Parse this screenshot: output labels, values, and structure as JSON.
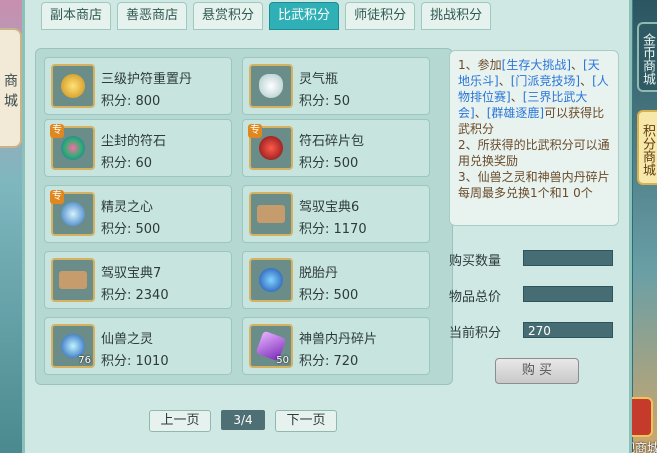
{
  "tabs": [
    {
      "label": "副本商店"
    },
    {
      "label": "善恶商店"
    },
    {
      "label": "悬赏积分"
    },
    {
      "label": "比武积分"
    },
    {
      "label": "师徒积分"
    },
    {
      "label": "挑战积分"
    }
  ],
  "active_tab": "比武积分",
  "side_left": {
    "label": "商城"
  },
  "side_right": [
    {
      "label": "金币商城"
    },
    {
      "label": "积分商城"
    }
  ],
  "chest_label": "外观商城",
  "items": [
    {
      "name": "三级护符重置丹",
      "price": "积分: 800",
      "icon": "golden-charm-icon",
      "badge": "",
      "count": ""
    },
    {
      "name": "灵气瓶",
      "price": "积分: 50",
      "icon": "white-bottle-icon",
      "badge": "",
      "count": ""
    },
    {
      "name": "尘封的符石",
      "price": "积分: 60",
      "icon": "colorful-rune-stone-icon",
      "badge": "专",
      "count": ""
    },
    {
      "name": "符石碎片包",
      "price": "积分: 500",
      "icon": "red-pouch-icon",
      "badge": "专",
      "count": ""
    },
    {
      "name": "精灵之心",
      "price": "积分: 500",
      "icon": "spirit-heart-icon",
      "badge": "专",
      "count": ""
    },
    {
      "name": "驾驭宝典6",
      "price": "积分: 1170",
      "icon": "open-book-icon",
      "badge": "",
      "count": ""
    },
    {
      "name": "驾驭宝典7",
      "price": "积分: 2340",
      "icon": "open-book-icon",
      "badge": "",
      "count": ""
    },
    {
      "name": "脱胎丹",
      "price": "积分: 500",
      "icon": "blue-pills-icon",
      "badge": "",
      "count": ""
    },
    {
      "name": "仙兽之灵",
      "price": "积分: 1010",
      "icon": "blue-orb-icon",
      "badge": "",
      "count": "76"
    },
    {
      "name": "神兽内丹碎片",
      "price": "积分: 720",
      "icon": "purple-crystal-icon",
      "badge": "",
      "count": "50"
    }
  ],
  "info": {
    "line1a": "1、参加",
    "link1": "[生存大挑战]",
    "sep1": "、",
    "link2": "[天地乐斗]",
    "sep2": "、",
    "link3": "[门派竞技场]",
    "sep3": "、",
    "link4": "[人物排位赛]",
    "sep4": "、",
    "link5": "[三界比武大会]",
    "sep5": "、",
    "link6": "[群雄逐鹿]",
    "line1b": "可以获得比武积分",
    "line2": "2、所获得的比武积分可以通用兑换奖励",
    "line3": "3、仙兽之灵和神兽内丹碎片每周最多兑换1个和1 0个"
  },
  "form": {
    "qty_label": "购买数量",
    "total_label": "物品总价",
    "points_label": "当前积分",
    "qty_value": "",
    "total_value": "",
    "points_value": "270"
  },
  "buy_button": "购 买",
  "pager": {
    "prev": "上一页",
    "page": "3/4",
    "next": "下一页"
  }
}
